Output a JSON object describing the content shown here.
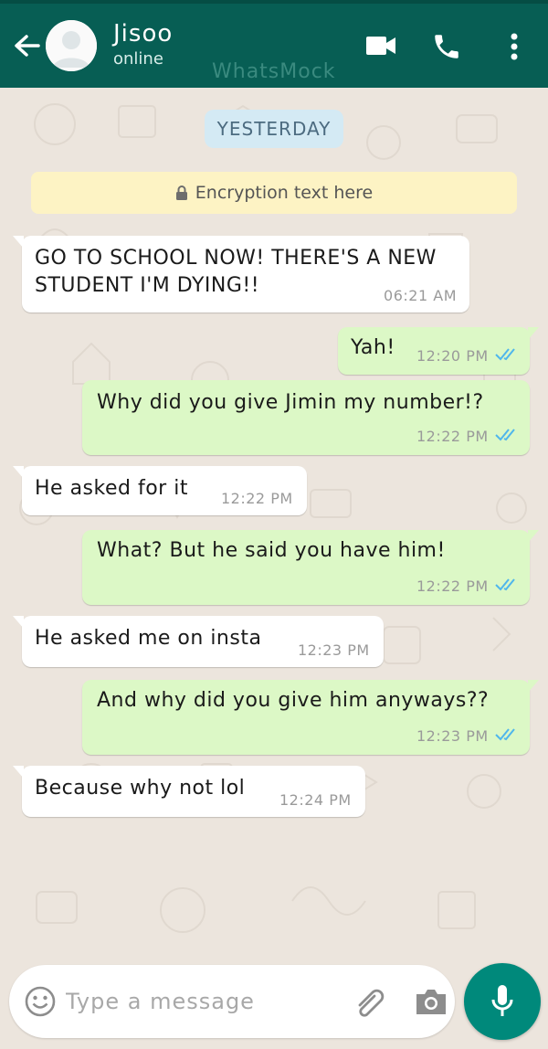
{
  "header": {
    "contact_name": "Jisoo",
    "status": "online",
    "watermark": "WhatsMock",
    "icons": [
      "back-arrow-icon",
      "avatar",
      "video-call-icon",
      "phone-icon",
      "more-options-icon"
    ]
  },
  "chat": {
    "date_chip": "YESTERDAY",
    "encryption_notice": "Encryption text here",
    "messages": [
      {
        "direction": "in",
        "text": "GO TO SCHOOL NOW! THERE'S A NEW\nSTUDENT I'M DYING!!",
        "time": "06:21 AM"
      },
      {
        "direction": "out",
        "text": "Yah!",
        "time": "12:20 PM",
        "read": true
      },
      {
        "direction": "out",
        "text": "Why did you give Jimin my number!?",
        "time": "12:22 PM",
        "read": true
      },
      {
        "direction": "in",
        "text": "He asked for it",
        "time": "12:22 PM"
      },
      {
        "direction": "out",
        "text": "What? But he said you have him!",
        "time": "12:22 PM",
        "read": true
      },
      {
        "direction": "in",
        "text": "He asked me on insta",
        "time": "12:23 PM"
      },
      {
        "direction": "out",
        "text": "And why did you give him anyways??",
        "time": "12:23 PM",
        "read": true
      },
      {
        "direction": "in",
        "text": "Because why not lol",
        "time": "12:24 PM"
      }
    ]
  },
  "composer": {
    "placeholder": "Type a message",
    "value": "",
    "icons": [
      "emoji-icon",
      "attach-icon",
      "camera-icon",
      "mic-icon"
    ]
  },
  "colors": {
    "header": "#075e54",
    "incoming_bubble": "#ffffff",
    "outgoing_bubble": "#dcf8c6",
    "read_ticks": "#4fb6ec",
    "mic_button": "#00897b",
    "chat_background": "#ece5dd"
  }
}
